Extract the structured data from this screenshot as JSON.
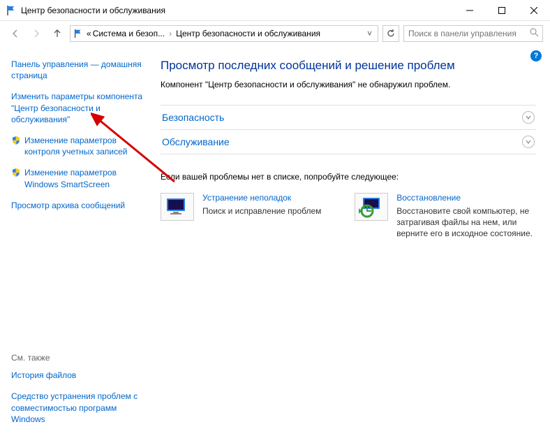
{
  "titlebar": {
    "title": "Центр безопасности и обслуживания"
  },
  "breadcrumb": {
    "prefix": "«",
    "crumb1": "Система и безоп...",
    "crumb2": "Центр безопасности и обслуживания"
  },
  "search": {
    "placeholder": "Поиск в панели управления"
  },
  "sidebar": {
    "home": "Панель управления — домашняя страница",
    "change_settings": "Изменить параметры компонента \"Центр безопасности и обслуживания\"",
    "uac": "Изменение параметров контроля учетных записей",
    "smartscreen": "Изменение параметров Windows SmartScreen",
    "archive": "Просмотр архива сообщений",
    "see_also_title": "См. также",
    "file_history": "История файлов",
    "compat": "Средство устранения проблем с совместимостью программ Windows"
  },
  "main": {
    "title": "Просмотр последних сообщений и решение проблем",
    "subtitle": "Компонент \"Центр безопасности и обслуживания\" не обнаружил проблем.",
    "section_security": "Безопасность",
    "section_maintenance": "Обслуживание",
    "try_text": "Если вашей проблемы нет в списке, попробуйте следующее:",
    "opt1_title": "Устранение неполадок",
    "opt1_desc": "Поиск и исправление проблем",
    "opt2_title": "Восстановление",
    "opt2_desc": "Восстановите свой компьютер, не затрагивая файлы на нем, или верните его в исходное состояние."
  }
}
